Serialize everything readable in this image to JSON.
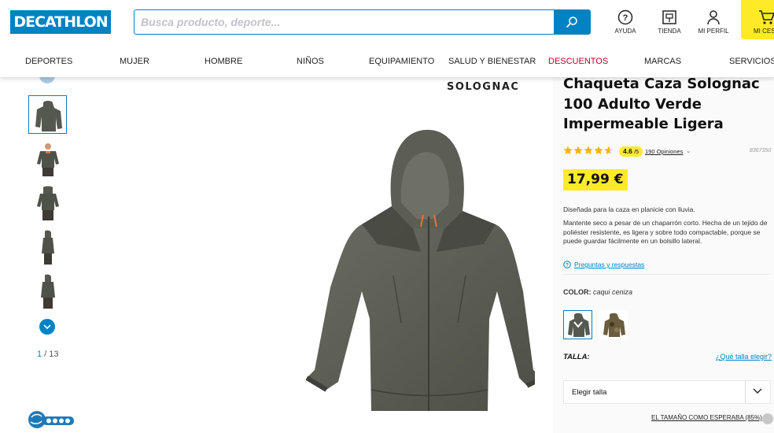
{
  "header": {
    "logo_text": "DECATHLON",
    "search_placeholder": "Busca producto, deporte...",
    "links": [
      {
        "label": "AYUDA",
        "icon": "help-icon"
      },
      {
        "label": "TIENDA",
        "icon": "store-icon"
      },
      {
        "label": "MI PERFIL",
        "icon": "user-icon"
      }
    ],
    "cart_label": "MI CES",
    "accent_color": "#0082c3",
    "cart_color": "#ffea28"
  },
  "nav": {
    "items": [
      "DEPORTES",
      "MUJER",
      "HOMBRE",
      "NIÑOS",
      "EQUIPAMIENTO",
      "SALUD Y BIENESTAR",
      "DESCUENTOS",
      "MARCAS",
      "SERVICIOS"
    ],
    "sale_color": "#c4012b"
  },
  "gallery": {
    "counter_current": "1",
    "counter_sep": " / ",
    "counter_total": "13",
    "brand_label": "SOLOGNAC",
    "thumb_count": 5
  },
  "product": {
    "title": "Chaqueta Caza Solognac 100 Adulto Verde Impermeable Ligera",
    "rating_value": "4.6",
    "rating_max": "/5",
    "stars_filled": 4.6,
    "opinions": "190 Opiniones",
    "ref": "8367350",
    "price": "17,99 €",
    "desc_short": "Diseñada para la caza en planicie con lluvia.",
    "desc_long": "Mantente seco a pesar de un chaparrón corto. Hecha de un tejido de poliéster resistente, es ligera y sobre todo compactable, porque se puede guardar fácilmente en un bolsillo lateral.",
    "qa_link": "Preguntas y respuestas",
    "color_label": "COLOR:",
    "color_value": "caqui ceniza",
    "size_label": "TALLA:",
    "size_help": "¿Qué talla elegir?",
    "size_select": "Elegir talla",
    "fit_text": "EL TAMAÑO COMO ESPERABA (85%)"
  }
}
